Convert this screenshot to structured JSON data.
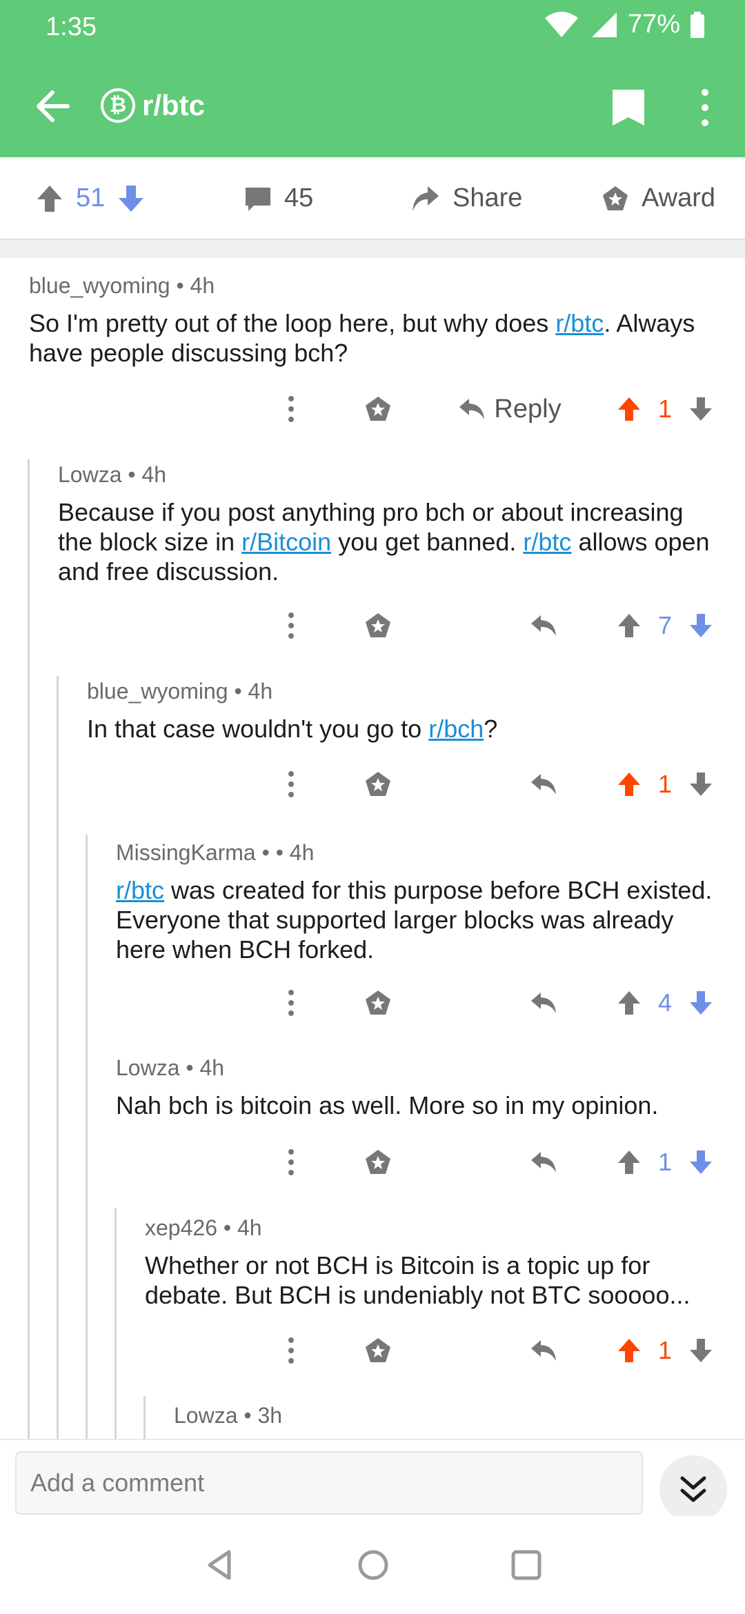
{
  "status_bar": {
    "time": "1:35",
    "battery": "77%"
  },
  "app_bar": {
    "subreddit": "r/btc",
    "coin_icon": "bitcoin-cash-icon"
  },
  "post_bar": {
    "score": "51",
    "comments": "45",
    "share_label": "Share",
    "award_label": "Award"
  },
  "comments": [
    {
      "author": "blue_wyoming",
      "age": "4h",
      "segments": [
        {
          "t": "So I'm pretty out of the loop here, but why does "
        },
        {
          "t": "r/btc",
          "link": true
        },
        {
          "t": ". Always have people discussing bch?"
        }
      ],
      "reply_label": "Reply",
      "score": "1",
      "vote": "up"
    },
    {
      "author": "Lowza",
      "age": "4h",
      "segments": [
        {
          "t": "Because if you post anything pro bch or about increasing the block size in "
        },
        {
          "t": "r/Bitcoin",
          "link": true
        },
        {
          "t": " you get banned. "
        },
        {
          "t": "r/btc",
          "link": true
        },
        {
          "t": " allows open and free discussion."
        }
      ],
      "score": "7",
      "vote": "none"
    },
    {
      "author": "blue_wyoming",
      "age": "4h",
      "segments": [
        {
          "t": "In that case wouldn't you go to "
        },
        {
          "t": "r/bch",
          "link": true
        },
        {
          "t": "?"
        }
      ],
      "score": "1",
      "vote": "up"
    },
    {
      "author": "MissingKarma",
      "flair": "•",
      "age": "4h",
      "segments": [
        {
          "t": "r/btc",
          "link": true
        },
        {
          "t": " was created for this purpose before BCH existed. Everyone that supported larger blocks was already here when BCH forked."
        }
      ],
      "score": "4",
      "vote": "none"
    },
    {
      "author": "Lowza",
      "age": "4h",
      "segments": [
        {
          "t": "Nah bch is bitcoin as well. More so in my opinion."
        }
      ],
      "score": "1",
      "vote": "none"
    },
    {
      "author": "xep426",
      "age": "4h",
      "segments": [
        {
          "t": "Whether or not BCH is Bitcoin is a topic up for debate. But BCH is undeniably not BTC sooooo..."
        }
      ],
      "score": "1",
      "vote": "up"
    },
    {
      "author": "Lowza",
      "age": "3h",
      "segments": []
    }
  ],
  "composer": {
    "placeholder": "Add a comment"
  },
  "colors": {
    "brand_green": "#5fca77",
    "upvote_orange": "#ff4500",
    "downvote_blue": "#6e8fe8",
    "link_blue": "#1a8fd6"
  }
}
